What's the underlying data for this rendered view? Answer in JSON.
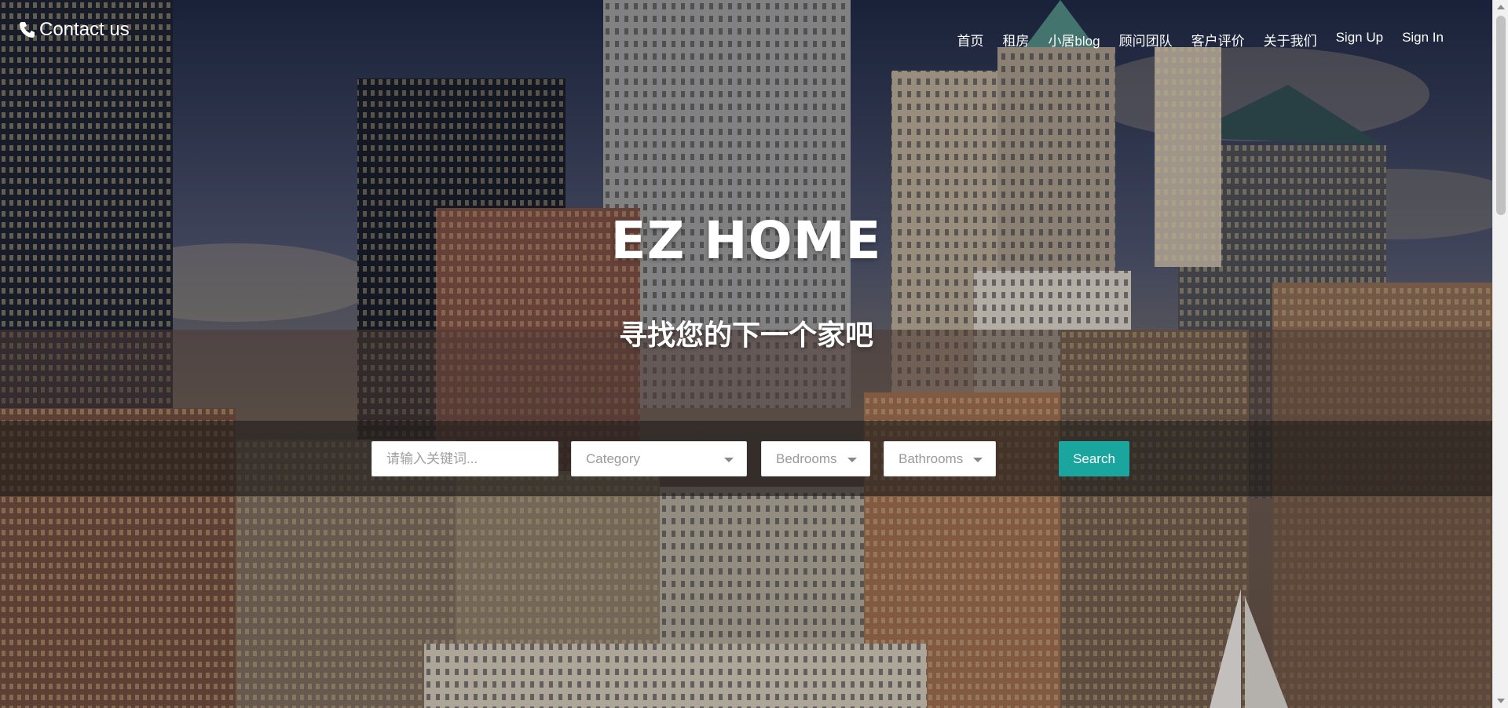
{
  "header": {
    "contact_label": "Contact us",
    "nav": [
      {
        "label": "首页"
      },
      {
        "label": "租房"
      },
      {
        "label": "小居blog"
      },
      {
        "label": "顾问团队"
      },
      {
        "label": "客户评价"
      },
      {
        "label": "关于我们"
      },
      {
        "label": "Sign Up"
      },
      {
        "label": "Sign In"
      }
    ]
  },
  "hero": {
    "title": "EZ HOME",
    "subtitle": "寻找您的下一个家吧"
  },
  "search": {
    "keyword_placeholder": "请输入关键词...",
    "category_label": "Category",
    "bedrooms_label": "Bedrooms",
    "bathrooms_label": "Bathrooms",
    "button_label": "Search"
  },
  "colors": {
    "accent": "#1aa59f",
    "text_on_hero": "#ffffff"
  },
  "icons": {
    "contact": "phone-icon",
    "dropdown": "chevron-down-icon"
  }
}
